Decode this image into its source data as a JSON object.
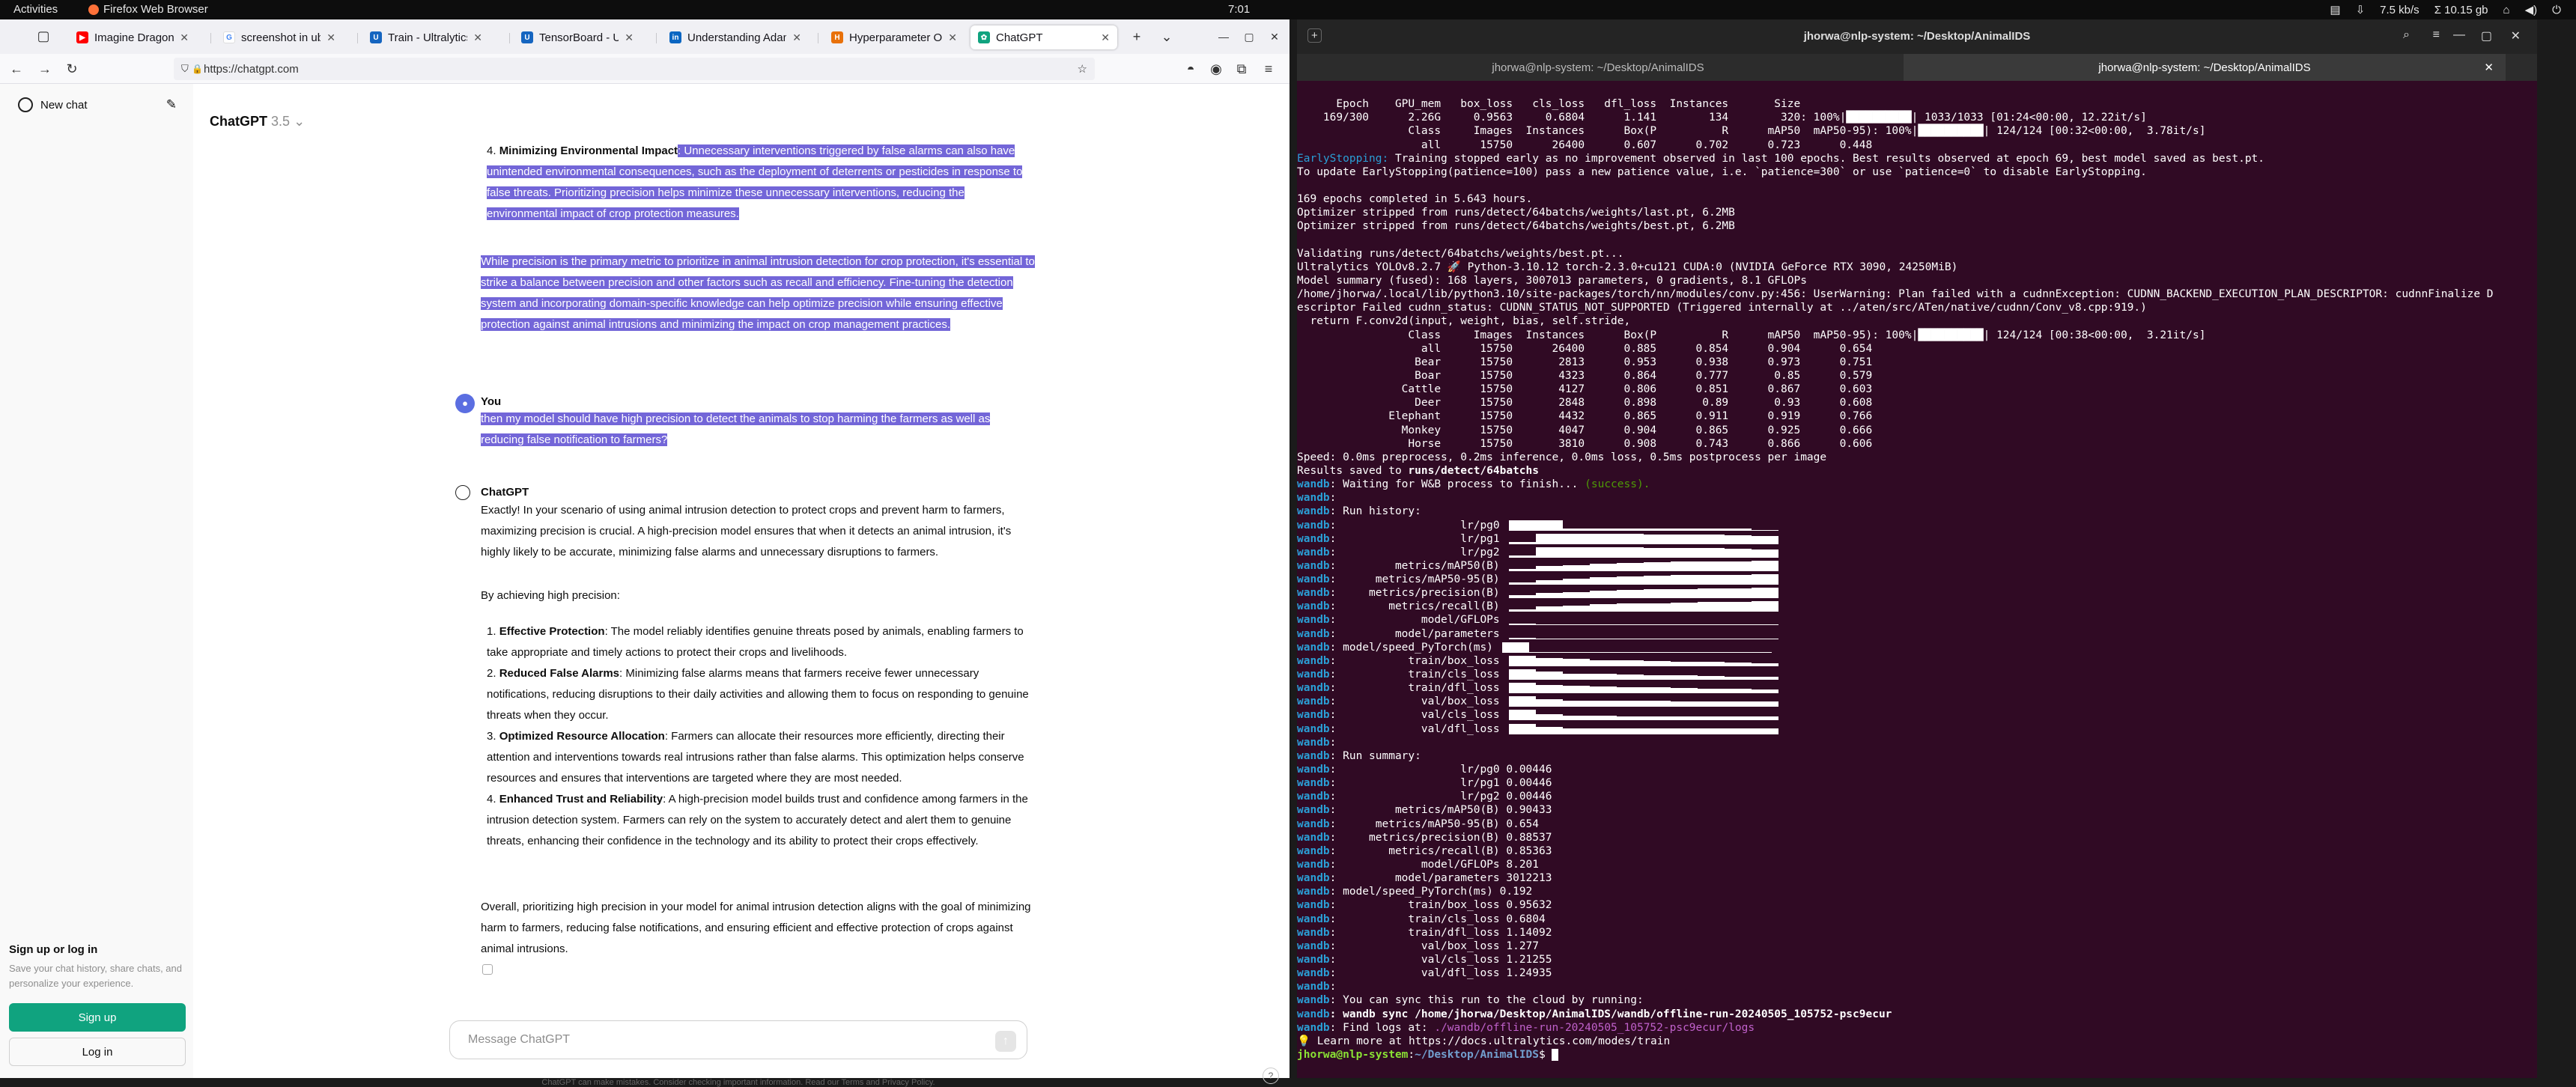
{
  "topbar": {
    "activities": "Activities",
    "app_name": "Firefox Web Browser",
    "clock": "7:01",
    "net_speed": "7.5 kb/s",
    "net_total": "Σ 10.15 gb"
  },
  "browser": {
    "url": "https://chatgpt.com",
    "tabs": [
      {
        "title": "Imagine Dragons - Be",
        "color": "#ff0000"
      },
      {
        "title": "screenshot in ubuntu",
        "color": "#4285f4"
      },
      {
        "title": "Train - Ultralytics YOL",
        "color": "#1565c0"
      },
      {
        "title": "TensorBoard - Ultraly",
        "color": "#1565c0"
      },
      {
        "title": "Understanding Adam",
        "color": "#0a66c2"
      },
      {
        "title": "Hyperparameter Opt",
        "color": "#e8710a"
      },
      {
        "title": "ChatGPT",
        "color": "#10a37f"
      }
    ]
  },
  "chatgpt": {
    "new_chat": "New chat",
    "model": "ChatGPT",
    "model_version": "3.5",
    "signup_title": "Sign up or log in",
    "signup_sub": "Save your chat history, share chats, and personalize your experience.",
    "signup_btn": "Sign up",
    "login_btn": "Log in",
    "input_placeholder": "Message ChatGPT",
    "disclaimer": "ChatGPT can make mistakes. Consider checking important information. Read our Terms and Privacy Policy.",
    "prev_item4_bold": "Minimizing Environmental Impact",
    "prev_item4_text": ": Unnecessary interventions triggered by false alarms can also have unintended environmental consequences, such as the deployment of deterrents or pesticides in response to false threats. Prioritizing precision helps minimize these unnecessary interventions, reducing the environmental impact of crop protection measures.",
    "prev_para": "While precision is the primary metric to prioritize in animal intrusion detection for crop protection, it's essential to strike a balance between precision and other factors such as recall and efficiency. Fine-tuning the detection system and incorporating domain-specific knowledge can help optimize precision while ensuring effective protection against animal intrusions and minimizing the impact on crop management practices.",
    "user_label": "You",
    "user_msg": "then my model should have high precision to detect the animals to stop harming the farmers as well as reducing false notification to farmers?",
    "bot_label": "ChatGPT",
    "answer_intro": "Exactly! In your scenario of using animal intrusion detection to protect crops and prevent harm to farmers, maximizing precision is crucial. A high-precision model ensures that when it detects an animal intrusion, it's highly likely to be accurate, minimizing false alarms and unnecessary disruptions to farmers.",
    "answer_sub": "By achieving high precision:",
    "answer_items": [
      {
        "bold": "Effective Protection",
        "text": ": The model reliably identifies genuine threats posed by animals, enabling farmers to take appropriate and timely actions to protect their crops and livelihoods."
      },
      {
        "bold": "Reduced False Alarms",
        "text": ": Minimizing false alarms means that farmers receive fewer unnecessary notifications, reducing disruptions to their daily activities and allowing them to focus on responding to genuine threats when they occur."
      },
      {
        "bold": "Optimized Resource Allocation",
        "text": ": Farmers can allocate their resources more efficiently, directing their attention and interventions towards real intrusions rather than false alarms. This optimization helps conserve resources and ensures that interventions are targeted where they are most needed."
      },
      {
        "bold": "Enhanced Trust and Reliability",
        "text": ": A high-precision model builds trust and confidence among farmers in the intrusion detection system. Farmers can rely on the system to accurately detect and alert them to genuine threats, enhancing their confidence in the technology and its ability to protect their crops effectively."
      }
    ],
    "answer_outro": "Overall, prioritizing high precision in your model for animal intrusion detection aligns with the goal of minimizing harm to farmers, reducing false notifications, and ensuring efficient and effective protection of crops against animal intrusions."
  },
  "terminal": {
    "title": "jhorwa@nlp-system: ~/Desktop/AnimalIDS",
    "tab1": "jhorwa@nlp-system: ~/Desktop/AnimalIDS",
    "tab2": "jhorwa@nlp-system: ~/Desktop/AnimalIDS",
    "lines": [
      "",
      "      Epoch    GPU_mem   box_loss   cls_loss   dfl_loss  Instances       Size",
      "    169/300      2.26G     0.9563     0.6804      1.141        134        320: 100%|██████████| 1033/1033 [01:24<00:00, 12.22it/s]",
      "                 Class     Images  Instances      Box(P          R      mAP50  mAP50-95): 100%|██████████| 124/124 [00:32<00:00,  3.78it/s]",
      "                   all      15750      26400      0.607      0.702      0.723      0.448",
      "EarlyStopping: Training stopped early as no improvement observed in last 100 epochs. Best results observed at epoch 69, best model saved as best.pt.",
      "To update EarlyStopping(patience=100) pass a new patience value, i.e. `patience=300` or use `patience=0` to disable EarlyStopping.",
      "",
      "169 epochs completed in 5.643 hours.",
      "Optimizer stripped from runs/detect/64batchs/weights/last.pt, 6.2MB",
      "Optimizer stripped from runs/detect/64batchs/weights/best.pt, 6.2MB",
      "",
      "Validating runs/detect/64batchs/weights/best.pt...",
      "Ultralytics YOLOv8.2.7 🚀 Python-3.10.12 torch-2.3.0+cu121 CUDA:0 (NVIDIA GeForce RTX 3090, 24250MiB)",
      "Model summary (fused): 168 layers, 3007013 parameters, 0 gradients, 8.1 GFLOPs",
      "/home/jhorwa/.local/lib/python3.10/site-packages/torch/nn/modules/conv.py:456: UserWarning: Plan failed with a cudnnException: CUDNN_BACKEND_EXECUTION_PLAN_DESCRIPTOR: cudnnFinalize D",
      "escriptor Failed cudnn_status: CUDNN_STATUS_NOT_SUPPORTED (Triggered internally at ../aten/src/ATen/native/cudnn/Conv_v8.cpp:919.)",
      "  return F.conv2d(input, weight, bias, self.stride,",
      "                 Class     Images  Instances      Box(P          R      mAP50  mAP50-95): 100%|██████████| 124/124 [00:38<00:00,  3.21it/s]",
      "                   all      15750      26400      0.885      0.854      0.904      0.654",
      "                  Bear      15750       2813      0.953      0.938      0.973      0.751",
      "                  Boar      15750       4323      0.864      0.777       0.85      0.579",
      "                Cattle      15750       4127      0.806      0.851      0.867      0.603",
      "                  Deer      15750       2848      0.898       0.89       0.93      0.608",
      "              Elephant      15750       4432      0.865      0.911      0.919      0.766",
      "                Monkey      15750       4047      0.904      0.865      0.925      0.666",
      "                 Horse      15750       3810      0.908      0.743      0.866      0.606",
      "Speed: 0.0ms preprocess, 0.2ms inference, 0.0ms loss, 0.5ms postprocess per image",
      "Results saved to runs/detect/64batchs",
      "wandb: Waiting for W&B process to finish... (success).",
      "wandb:",
      "wandb: Run history:",
      "wandb:                   lr/pg0",
      "wandb:                   lr/pg1",
      "wandb:                   lr/pg2",
      "wandb:         metrics/mAP50(B)",
      "wandb:      metrics/mAP50-95(B)",
      "wandb:     metrics/precision(B)",
      "wandb:        metrics/recall(B)",
      "wandb:             model/GFLOPs",
      "wandb:         model/parameters",
      "wandb: model/speed_PyTorch(ms)",
      "wandb:           train/box_loss",
      "wandb:           train/cls_loss",
      "wandb:           train/dfl_loss",
      "wandb:             val/box_loss",
      "wandb:             val/cls_loss",
      "wandb:             val/dfl_loss",
      "wandb:",
      "wandb: Run summary:",
      "wandb:                   lr/pg0 0.00446",
      "wandb:                   lr/pg1 0.00446",
      "wandb:                   lr/pg2 0.00446",
      "wandb:         metrics/mAP50(B) 0.90433",
      "wandb:      metrics/mAP50-95(B) 0.654",
      "wandb:     metrics/precision(B) 0.88537",
      "wandb:        metrics/recall(B) 0.85363",
      "wandb:             model/GFLOPs 8.201",
      "wandb:         model/parameters 3012213",
      "wandb: model/speed_PyTorch(ms) 0.192",
      "wandb:           train/box_loss 0.95632",
      "wandb:           train/cls_loss 0.6804",
      "wandb:           train/dfl_loss 1.14092",
      "wandb:             val/box_loss 1.277",
      "wandb:             val/cls_loss 1.21255",
      "wandb:             val/dfl_loss 1.24935",
      "wandb:",
      "wandb: You can sync this run to the cloud by running:",
      "wandb: wandb sync /home/jhorwa/Desktop/AnimalIDS/wandb/offline-run-20240505_105752-psc9ecur",
      "wandb: Find logs at: ./wandb/offline-run-20240505_105752-psc9ecur/logs",
      "💡 Learn more at https://docs.ultralytics.com/modes/train",
      "jhorwa@nlp-system:~/Desktop/AnimalIDS$ "
    ]
  }
}
